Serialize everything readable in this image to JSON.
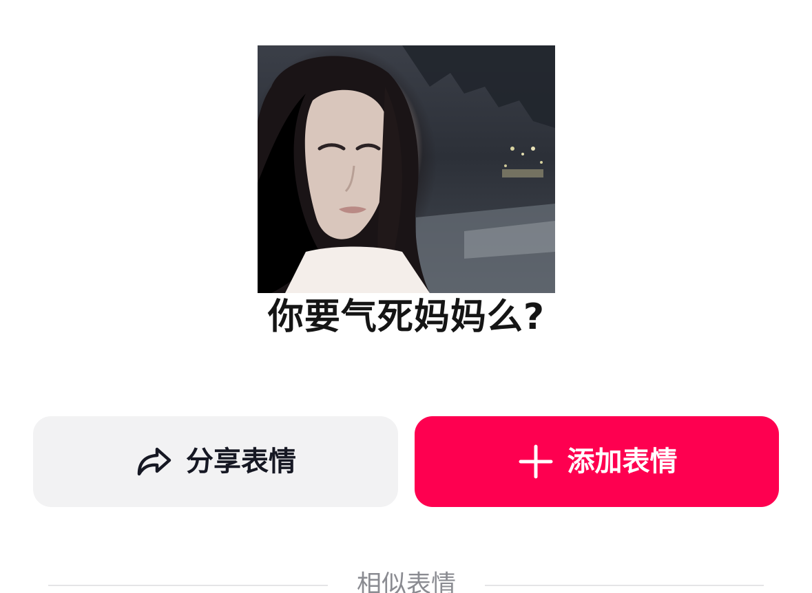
{
  "sticker": {
    "caption": "你要气死妈妈么?"
  },
  "actions": {
    "share_label": "分享表情",
    "share_icon": "share-arrow-icon",
    "add_label": "添加表情",
    "add_icon": "plus-icon"
  },
  "similar": {
    "title": "相似表情"
  },
  "colors": {
    "accent": "#fe0050",
    "secondary_button_bg": "#f2f2f3",
    "text_primary": "#161823",
    "text_muted": "#8a8b91"
  }
}
